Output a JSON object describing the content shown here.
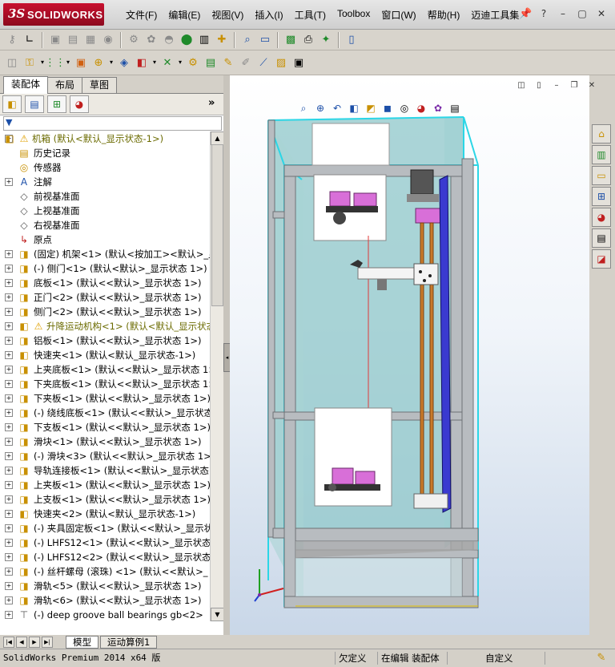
{
  "app": {
    "logo_ds": "3S",
    "logo_text": "SOLIDWORKS",
    "menu": [
      "文件(F)",
      "编辑(E)",
      "视图(V)",
      "插入(I)",
      "工具(T)",
      "Toolbox",
      "窗口(W)",
      "帮助(H)",
      "迈迪工具集"
    ],
    "window_controls": [
      "?",
      "–",
      "▢",
      "✕"
    ]
  },
  "panel": {
    "tabs": [
      "装配体",
      "布局",
      "草图"
    ],
    "active_tab": 0,
    "more_symbol": "»",
    "filter_symbol": "▼"
  },
  "tree": [
    {
      "label": "机箱  (默认<默认_显示状态-1>)",
      "level": 0,
      "icon": "assembly-icon",
      "warn": true,
      "expand": "−"
    },
    {
      "label": "历史记录",
      "level": 1,
      "icon": "history-icon",
      "expand": ""
    },
    {
      "label": "传感器",
      "level": 1,
      "icon": "sensor-icon",
      "expand": ""
    },
    {
      "label": "注解",
      "level": 1,
      "icon": "annotation-icon",
      "expand": "+"
    },
    {
      "label": "前视基准面",
      "level": 1,
      "icon": "plane-icon",
      "expand": ""
    },
    {
      "label": "上视基准面",
      "level": 1,
      "icon": "plane-icon",
      "expand": ""
    },
    {
      "label": "右视基准面",
      "level": 1,
      "icon": "plane-icon",
      "expand": ""
    },
    {
      "label": "原点",
      "level": 1,
      "icon": "origin-icon",
      "expand": ""
    },
    {
      "label": "(固定) 机架<1> (默认<按加工><默认>_显",
      "level": 1,
      "icon": "part-icon",
      "expand": "+"
    },
    {
      "label": "(-) 侧门<1> (默认<默认>_显示状态 1>)",
      "level": 1,
      "icon": "part-icon",
      "expand": "+"
    },
    {
      "label": "底板<1> (默认<<默认>_显示状态 1>)",
      "level": 1,
      "icon": "part-icon",
      "expand": "+"
    },
    {
      "label": "正门<2> (默认<<默认>_显示状态 1>)",
      "level": 1,
      "icon": "part-icon",
      "expand": "+"
    },
    {
      "label": "侧门<2> (默认<<默认>_显示状态 1>)",
      "level": 1,
      "icon": "part-icon",
      "expand": "+"
    },
    {
      "label": "升降运动机构<1> (默认<默认_显示状态",
      "level": 1,
      "icon": "assembly-icon",
      "warn": true,
      "expand": "+"
    },
    {
      "label": "铝板<1> (默认<<默认>_显示状态 1>)",
      "level": 1,
      "icon": "part-icon",
      "expand": "+"
    },
    {
      "label": "快速夹<1> (默认<默认_显示状态-1>)",
      "level": 1,
      "icon": "assembly-icon",
      "expand": "+"
    },
    {
      "label": "上夹底板<1> (默认<<默认>_显示状态 1>)",
      "level": 1,
      "icon": "part-icon",
      "expand": "+"
    },
    {
      "label": "下夹底板<1> (默认<<默认>_显示状态 1>)",
      "level": 1,
      "icon": "part-icon",
      "expand": "+"
    },
    {
      "label": "下夹板<1> (默认<<默认>_显示状态 1>)",
      "level": 1,
      "icon": "part-icon",
      "expand": "+"
    },
    {
      "label": "(-) 绕线底板<1> (默认<<默认>_显示状态",
      "level": 1,
      "icon": "part-icon",
      "expand": "+"
    },
    {
      "label": "下支板<1> (默认<<默认>_显示状态 1>)",
      "level": 1,
      "icon": "part-icon",
      "expand": "+"
    },
    {
      "label": "滑块<1> (默认<<默认>_显示状态 1>)",
      "level": 1,
      "icon": "part-icon",
      "expand": "+"
    },
    {
      "label": "(-) 滑块<3> (默认<<默认>_显示状态 1>)",
      "level": 1,
      "icon": "part-icon",
      "expand": "+"
    },
    {
      "label": "导轨连接板<1> (默认<<默认>_显示状态 1",
      "level": 1,
      "icon": "part-icon",
      "expand": "+"
    },
    {
      "label": "上夹板<1> (默认<<默认>_显示状态 1>)",
      "level": 1,
      "icon": "part-icon",
      "expand": "+"
    },
    {
      "label": "上支板<1> (默认<<默认>_显示状态 1>)",
      "level": 1,
      "icon": "part-icon",
      "expand": "+"
    },
    {
      "label": "快速夹<2> (默认<默认_显示状态-1>)",
      "level": 1,
      "icon": "assembly-icon",
      "expand": "+"
    },
    {
      "label": "(-) 夹具固定板<1> (默认<<默认>_显示状",
      "level": 1,
      "icon": "part-icon",
      "expand": "+"
    },
    {
      "label": "(-) LHFS12<1> (默认<<默认>_显示状态 1",
      "level": 1,
      "icon": "part-icon",
      "expand": "+"
    },
    {
      "label": "(-) LHFS12<2> (默认<<默认>_显示状态 1",
      "level": 1,
      "icon": "part-icon",
      "expand": "+"
    },
    {
      "label": "(-) 丝杆螺母 (滚珠) <1> (默认<<默认>_",
      "level": 1,
      "icon": "part-icon",
      "expand": "+"
    },
    {
      "label": "滑轨<5> (默认<<默认>_显示状态 1>)",
      "level": 1,
      "icon": "part-icon",
      "expand": "+"
    },
    {
      "label": "滑轨<6> (默认<<默认>_显示状态 1>)",
      "level": 1,
      "icon": "part-icon",
      "expand": "+"
    },
    {
      "label": "(-) deep groove ball bearings gb<2>",
      "level": 1,
      "icon": "toolbox-part-icon",
      "expand": "+"
    }
  ],
  "bottom_tabs": [
    "模型",
    "运动算例1"
  ],
  "status": {
    "version": "SolidWorks Premium 2014 x64 版",
    "underdefined": "欠定义",
    "editing": "在编辑 装配体",
    "custom": "自定义"
  },
  "colors": {
    "warn_text": "#6b6b00",
    "frame": "#2bd6e6",
    "panel_magenta": "#d86fd8",
    "rail_orange": "#c97a2a",
    "rail_blue": "#3a3ad0"
  }
}
